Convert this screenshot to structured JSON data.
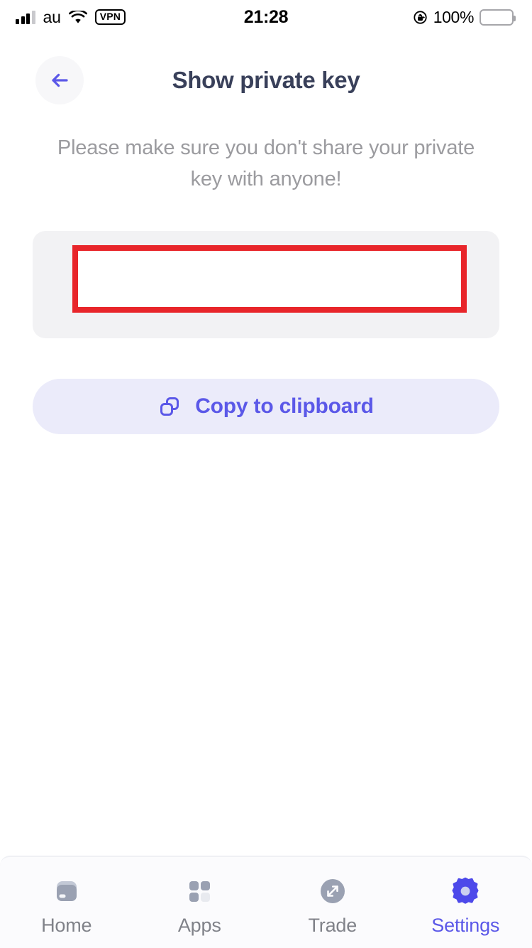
{
  "status_bar": {
    "carrier": "au",
    "signal_icon": "signal-bars-icon",
    "wifi_icon": "wifi-icon",
    "vpn_badge": "VPN",
    "time": "21:28",
    "rotation_lock_icon": "rotation-lock-icon",
    "battery_percent": "100%",
    "battery_icon": "battery-full-icon"
  },
  "header": {
    "back_icon": "arrow-left-icon",
    "title": "Show private key"
  },
  "content": {
    "subtitle": "Please make sure you don't share your private key with anyone!",
    "private_key_value": "",
    "redaction_note": "private key hidden by red annotation box"
  },
  "copy_button": {
    "label": "Copy to clipboard",
    "icon": "copy-icon"
  },
  "tab_bar": {
    "items": [
      {
        "label": "Home",
        "icon": "wallet-icon",
        "active": false
      },
      {
        "label": "Apps",
        "icon": "grid-icon",
        "active": false
      },
      {
        "label": "Trade",
        "icon": "exchange-icon",
        "active": false
      },
      {
        "label": "Settings",
        "icon": "gear-icon",
        "active": true
      }
    ]
  },
  "colors": {
    "accent": "#5b58e8",
    "accent_soft": "#ebebfa",
    "title": "#39405a",
    "muted": "#9b9b9f",
    "card": "#f2f2f4",
    "annotation_red": "#e8252a",
    "tab_inactive": "#808289",
    "tab_icon_gray": "#9aa1b2"
  }
}
